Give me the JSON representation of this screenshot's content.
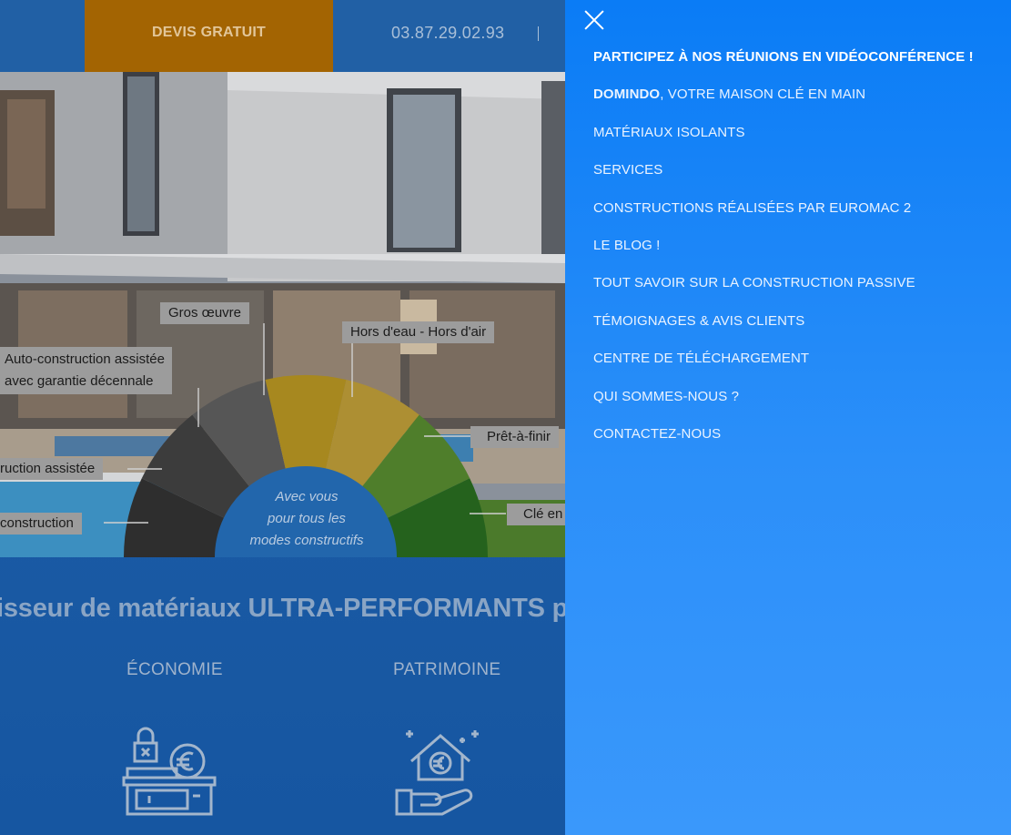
{
  "topbar": {
    "devis_label": "DEVIS GRATUIT",
    "phone": "03.87.29.02.93"
  },
  "wheel": {
    "center_text_lines": [
      "Avec vous",
      "pour tous les",
      "modes constructifs"
    ],
    "labels": {
      "gros_oeuvre": "Gros œuvre",
      "hors_eau": "Hors d'eau - Hors d'air",
      "auto_garantie_1": "Auto-construction assistée",
      "auto_garantie_2": "avec garantie décennale",
      "pret_a_finir": "Prêt-à-finir",
      "auto_assistee": "ruction assistée",
      "cle_en": "Clé en",
      "auto_construction": "construction"
    },
    "segment_colors": [
      "#2e2e2e",
      "#3c3c3c",
      "#565656",
      "#a7881f",
      "#ad8f33",
      "#4f7e2b",
      "#25621d"
    ]
  },
  "content": {
    "headline": "isseur de matériaux ULTRA-PERFORMANTS p",
    "col1_title": "ÉCONOMIE",
    "col2_title": "PATRIMOINE",
    "col1_icon": "safe-euro-icon",
    "col2_icon": "house-euro-hand-icon"
  },
  "menu": {
    "close_icon": "close-icon",
    "items": [
      {
        "label": "PARTICIPEZ À NOS RÉUNIONS EN VIDÉOCONFÉRENCE !"
      },
      {
        "bold": "DOMINDO",
        "label": ", VOTRE MAISON CLÉ EN MAIN"
      },
      {
        "label": "MATÉRIAUX ISOLANTS"
      },
      {
        "label": "SERVICES"
      },
      {
        "label": "CONSTRUCTIONS RÉALISÉES PAR EUROMAC 2"
      },
      {
        "label": "LE BLOG !"
      },
      {
        "label": "TOUT SAVOIR SUR LA CONSTRUCTION PASSIVE"
      },
      {
        "label": "TÉMOIGNAGES & AVIS CLIENTS"
      },
      {
        "label": "CENTRE DE TÉLÉCHARGEMENT"
      },
      {
        "label": "QUI SOMMES-NOUS ?"
      },
      {
        "label": "CONTACTEZ-NOUS"
      }
    ]
  }
}
